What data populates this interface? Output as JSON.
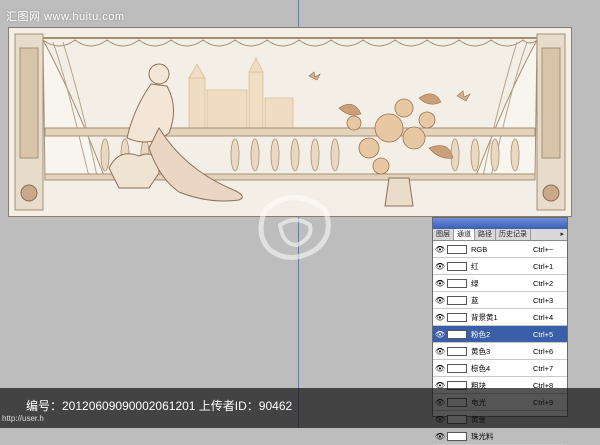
{
  "watermark": {
    "site": "汇图网 www.huitu.com"
  },
  "panel": {
    "tabs": [
      {
        "label": "图层",
        "active": false
      },
      {
        "label": "通道",
        "active": true
      },
      {
        "label": "路径",
        "active": false
      },
      {
        "label": "历史记录",
        "active": false
      }
    ],
    "channels": [
      {
        "name": "RGB",
        "shortcut": "Ctrl+~",
        "selected": false
      },
      {
        "name": "红",
        "shortcut": "Ctrl+1",
        "selected": false
      },
      {
        "name": "绿",
        "shortcut": "Ctrl+2",
        "selected": false
      },
      {
        "name": "蓝",
        "shortcut": "Ctrl+3",
        "selected": false
      },
      {
        "name": "背景黄1",
        "shortcut": "Ctrl+4",
        "selected": false
      },
      {
        "name": "粉色2",
        "shortcut": "Ctrl+5",
        "selected": true
      },
      {
        "name": "黄色3",
        "shortcut": "Ctrl+6",
        "selected": false
      },
      {
        "name": "棕色4",
        "shortcut": "Ctrl+7",
        "selected": false
      },
      {
        "name": "粗块",
        "shortcut": "Ctrl+8",
        "selected": false
      },
      {
        "name": "电光",
        "shortcut": "Ctrl+9",
        "selected": false
      },
      {
        "name": "黄金",
        "shortcut": "",
        "selected": false
      },
      {
        "name": "珠光料",
        "shortcut": "",
        "selected": false
      }
    ]
  },
  "footer": {
    "info": "编号：20120609090002061201 上传者ID：90462",
    "status": "http://user.h"
  },
  "colors": {
    "selected_row": "#3a5fa8",
    "artwork_line": "#a58f74"
  }
}
